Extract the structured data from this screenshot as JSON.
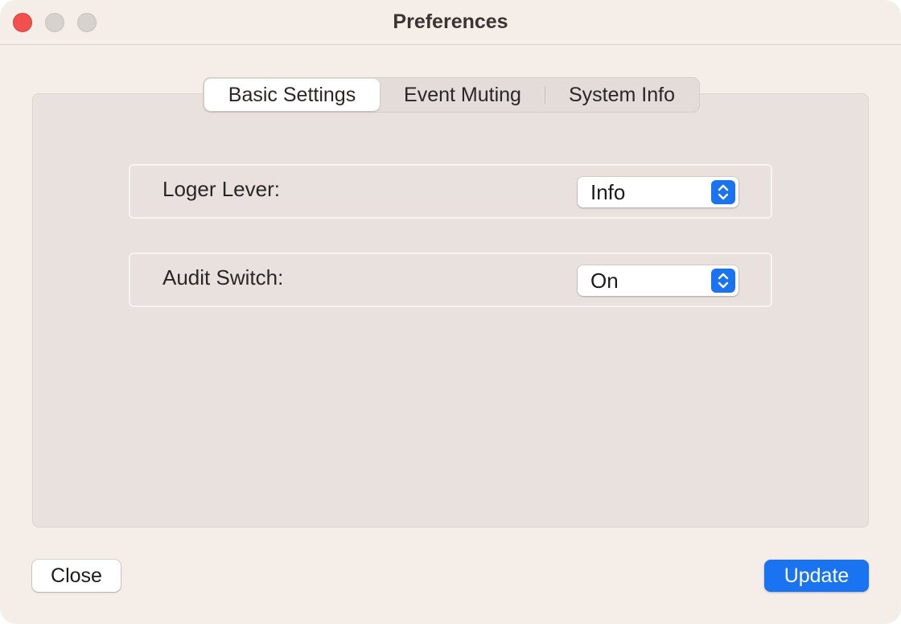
{
  "window": {
    "title": "Preferences"
  },
  "tabs": [
    {
      "label": "Basic Settings",
      "selected": true
    },
    {
      "label": "Event Muting",
      "selected": false
    },
    {
      "label": "System Info",
      "selected": false
    }
  ],
  "settings": {
    "log_level": {
      "label": "Loger Lever:",
      "value": "Info"
    },
    "audit_switch": {
      "label": "Audit Switch:",
      "value": "On"
    }
  },
  "footer": {
    "close_label": "Close",
    "update_label": "Update"
  },
  "colors": {
    "accent": "#1a73f0",
    "window_bg": "#f4ede8",
    "panel_bg": "#e8e1de",
    "close_dot": "#f2504c"
  },
  "icons": {
    "window_close": "close-icon",
    "window_minimize": "minimize-icon",
    "window_zoom": "zoom-icon",
    "select_arrows": "chevron-up-down-icon"
  }
}
